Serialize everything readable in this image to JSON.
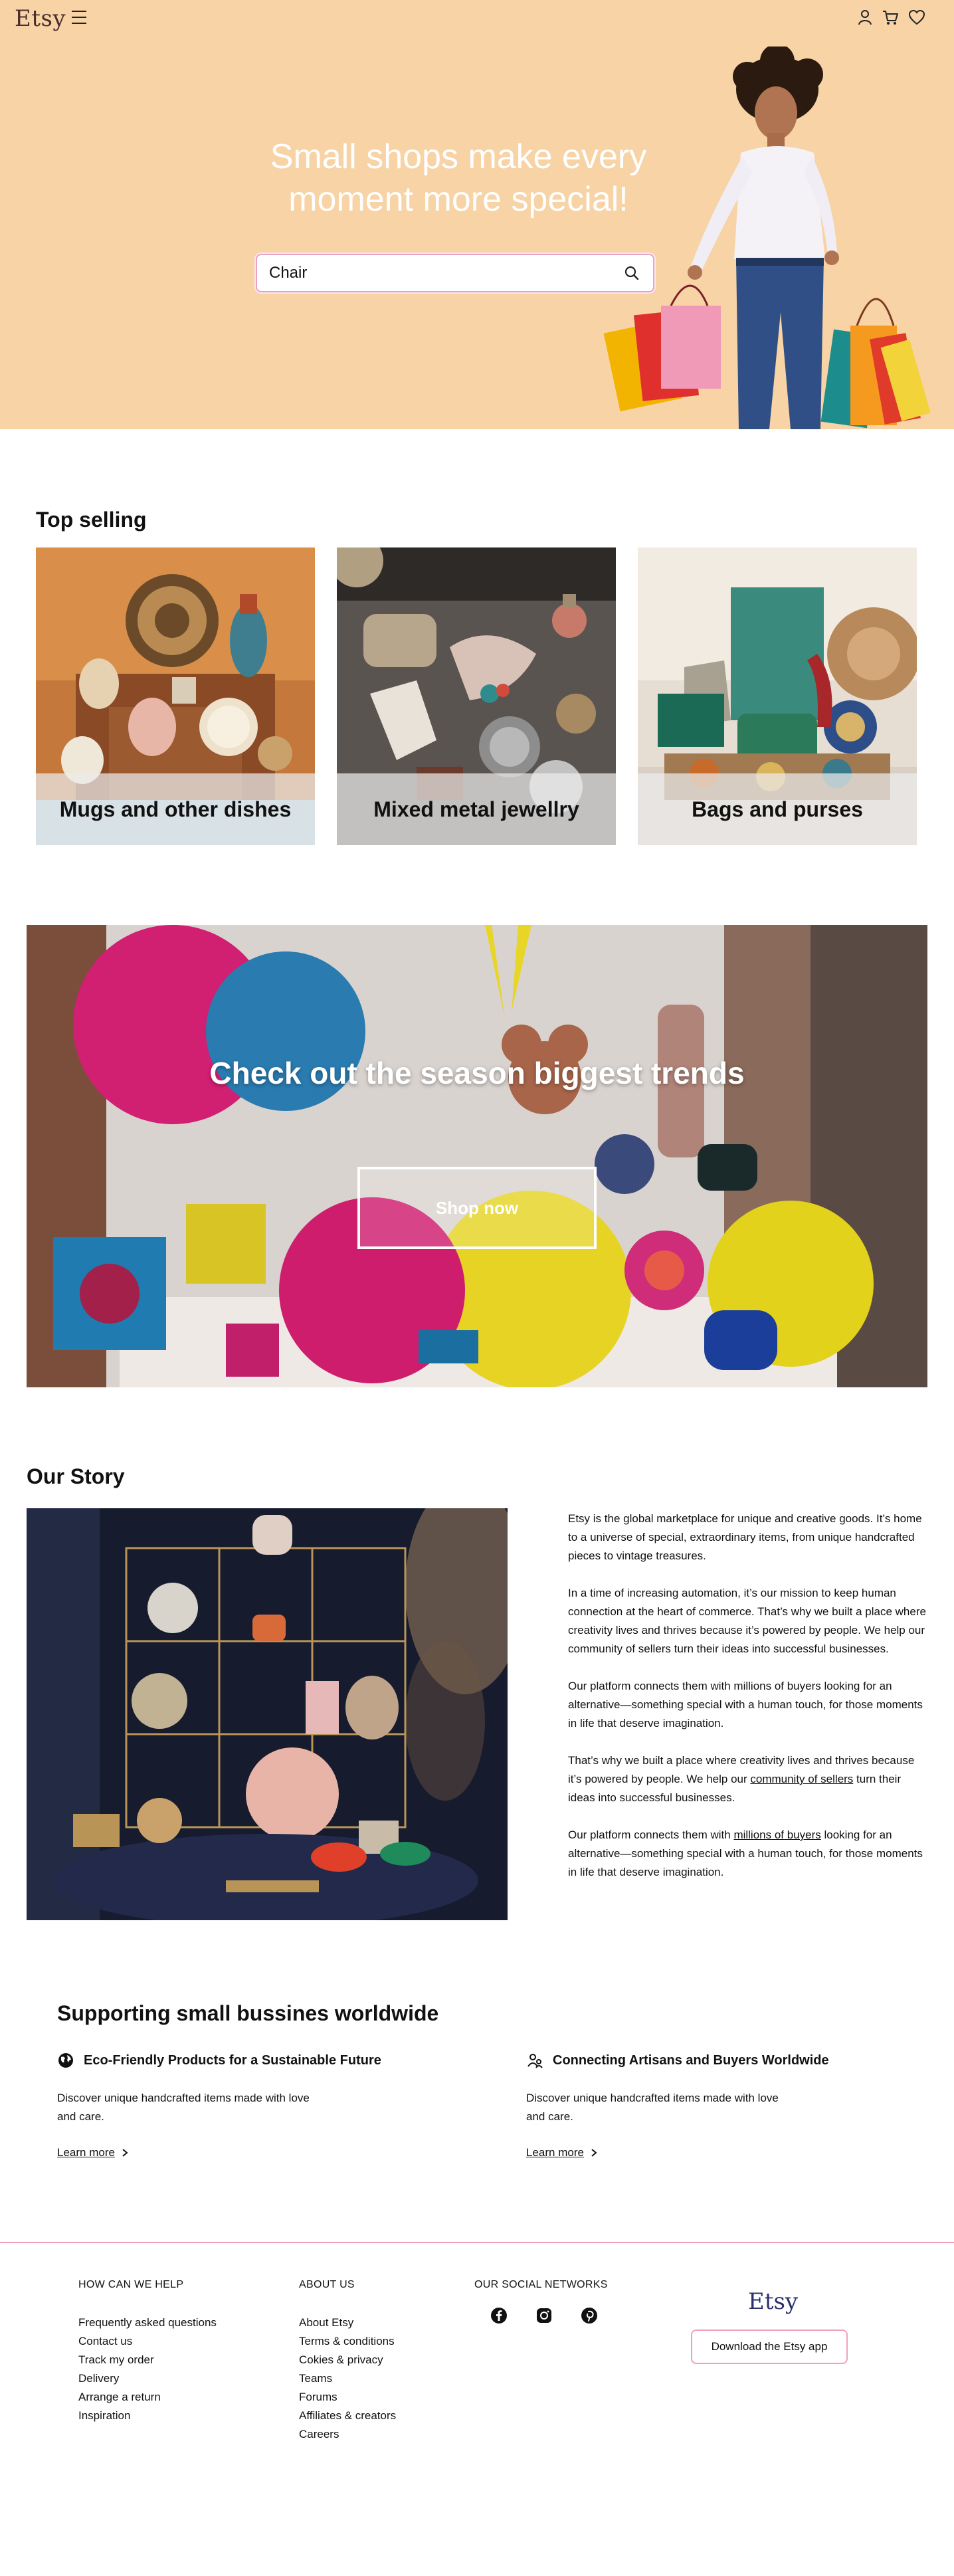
{
  "header": {
    "logo": "Etsy",
    "menu_icon": "hamburger-menu-icon",
    "account_icon": "user-icon",
    "cart_icon": "cart-icon",
    "favorites_icon": "heart-icon"
  },
  "hero": {
    "title": "Small shops make every moment more special!",
    "search": {
      "value": "Chair",
      "icon": "search-icon"
    },
    "background": "#f7d3a6"
  },
  "top_selling": {
    "title": "Top selling",
    "cards": [
      {
        "label": "Mugs and other  dishes"
      },
      {
        "label": "Mixed metal jewellry"
      },
      {
        "label": "Bags and purses"
      }
    ]
  },
  "banner": {
    "title": "Check out the season biggest trends",
    "button": "Shop now"
  },
  "story": {
    "title": "Our Story",
    "p1": "Etsy is the global marketplace for unique and creative goods. It’s home to a universe of special, extraordinary items, from unique handcrafted pieces to vintage treasures.",
    "p2": "In a time of increasing automation, it’s our mission to keep human connection at the heart of commerce. That’s why we built a place where creativity lives and thrives because it’s powered by people. We help our community of sellers turn their ideas into successful businesses.",
    "p3": " Our platform connects them with millions of buyers looking for an alternative—something special with a human touch, for those moments in life that deserve imagination.",
    "p4_a": "That’s why we built a place where creativity lives and thrives because it’s powered by people. We help our ",
    "p4_link": "community of sellers",
    "p4_b": " turn their ideas into successful businesses.",
    "p5_a": "Our platform connects them with ",
    "p5_link": "millions of buyers",
    "p5_b": " looking for an alternative—something special with a human touch, for those moments in life that deserve imagination."
  },
  "supporting": {
    "title": "Supporting small bussines worldwide",
    "features": [
      {
        "icon": "globe-icon",
        "title": "Eco-Friendly Products for a Sustainable Future",
        "desc": "Discover unique handcrafted items made with love and care.",
        "link": "Learn more"
      },
      {
        "icon": "people-icon",
        "title": "Connecting Artisans and Buyers Worldwide",
        "desc": "Discover unique handcrafted items made with love and care.",
        "link": "Learn more"
      }
    ]
  },
  "footer": {
    "help": {
      "title": "HOW CAN WE HELP",
      "links": [
        "Frequently asked questions",
        "Contact us",
        "Track my order",
        "Delivery",
        "Arrange a return",
        "Inspiration"
      ]
    },
    "about": {
      "title": "ABOUT US",
      "links": [
        "About Etsy",
        "Terms & conditions",
        "Cokies & privacy",
        "Teams",
        "Forums",
        "Affiliates & creators",
        "Careers"
      ]
    },
    "social": {
      "title": "OUR SOCIAL NETWORKS",
      "icons": [
        "facebook-icon",
        "instagram-icon",
        "pinterest-icon"
      ]
    },
    "logo": "Etsy",
    "app_button": "Download the Etsy app"
  }
}
